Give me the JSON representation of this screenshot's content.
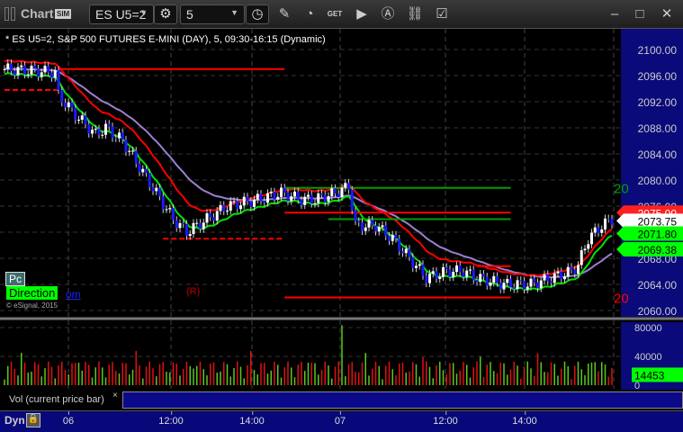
{
  "titlebar": {
    "title": "Chart",
    "sim_badge": "SIM",
    "symbol": "ES U5=2",
    "interval": "5",
    "get_label": "GET"
  },
  "legend": "* ES U5=2, S&P 500 FUTURES E-MINI (DAY), 5, 09:30-16:15 (Dynamic)",
  "overlays": {
    "pc": "Pc",
    "direction": "Direction",
    "direction_suffix": "om",
    "copyright": "© eSignal, 2015",
    "r_marker": "(R)",
    "green_level_label": "20",
    "red_level_label": "20"
  },
  "volume_panel": {
    "label": "Vol (current price bar)",
    "close": "×",
    "tags": {
      "current": "14453"
    }
  },
  "bottom": {
    "dyn": "Dyn"
  },
  "colors": {
    "up": "#ffffff",
    "down": "#1a1aff",
    "axis_bg": "#0a0a7a",
    "red": "#ff0000",
    "green": "#00ff00",
    "purple": "#9b7fd0"
  },
  "chart_data": {
    "type": "candlestick",
    "title": "ES U5=2, S&P 500 FUTURES E-MINI (DAY), 5",
    "price_axis": {
      "ylim": [
        2060,
        2102
      ],
      "ticks": [
        "2100.00",
        "2096.00",
        "2092.00",
        "2088.00",
        "2084.00",
        "2080.00",
        "2076.00",
        "2072.00",
        "2068.00",
        "2064.00",
        "2060.00"
      ]
    },
    "time_ticks": [
      "06",
      "12:00",
      "14:00",
      "07",
      "12:00",
      "14:00"
    ],
    "price_tags": [
      {
        "label": "2075.00",
        "color": "#ff2020",
        "text": "#fff",
        "value": 2075.0
      },
      {
        "label": "2073.75",
        "color": "#ffffff",
        "text": "#000",
        "value": 2073.75
      },
      {
        "label": "2071.80",
        "color": "#00ff00",
        "text": "#000",
        "value": 2071.8
      },
      {
        "label": "2069.38",
        "color": "#00ff00",
        "text": "#000",
        "value": 2069.38
      }
    ],
    "close_waypoints": [
      [
        0,
        2097
      ],
      [
        15,
        2096.5
      ],
      [
        16,
        2093
      ],
      [
        21,
        2090
      ],
      [
        27,
        2087
      ],
      [
        30,
        2088
      ],
      [
        35,
        2086
      ],
      [
        40,
        2082
      ],
      [
        45,
        2078
      ],
      [
        50,
        2074
      ],
      [
        54,
        2072
      ],
      [
        60,
        2074
      ],
      [
        66,
        2076
      ],
      [
        75,
        2077
      ],
      [
        82,
        2078
      ],
      [
        88,
        2077
      ],
      [
        92,
        2077
      ],
      [
        98,
        2078
      ],
      [
        102,
        2079
      ],
      [
        104,
        2073
      ],
      [
        110,
        2073
      ],
      [
        115,
        2071
      ],
      [
        120,
        2068
      ],
      [
        125,
        2065
      ],
      [
        131,
        2066
      ],
      [
        136,
        2066
      ],
      [
        140,
        2065
      ],
      [
        148,
        2064
      ],
      [
        156,
        2064
      ],
      [
        162,
        2065
      ],
      [
        168,
        2066
      ],
      [
        170,
        2067
      ],
      [
        173,
        2071
      ],
      [
        177,
        2073
      ],
      [
        180,
        2074
      ]
    ],
    "levels": [
      {
        "value": 2097,
        "from": 16,
        "to": 83,
        "color": "#ff0000",
        "style": "solid"
      },
      {
        "value": 2093.8,
        "from": 0,
        "to": 16,
        "color": "#ff0000",
        "style": "dashed"
      },
      {
        "value": 2071,
        "from": 47,
        "to": 83,
        "color": "#ff0000",
        "style": "dashed"
      },
      {
        "value": 2078.8,
        "from": 83,
        "to": 150,
        "color": "#00a000",
        "style": "solid"
      },
      {
        "value": 2075,
        "from": 83,
        "to": 150,
        "color": "#ff0000",
        "style": "solid"
      },
      {
        "value": 2074,
        "from": 96,
        "to": 150,
        "color": "#00a000",
        "style": "solid"
      },
      {
        "value": 2062,
        "from": 83,
        "to": 150,
        "color": "#ff0000",
        "style": "solid"
      },
      {
        "value": 2066.8,
        "from": 140,
        "to": 150,
        "color": "#ff0000",
        "style": "solid"
      }
    ],
    "volume": {
      "ylim": [
        0,
        90000
      ],
      "ticks": [
        "80000",
        "40000",
        "0"
      ],
      "last": 14453
    }
  }
}
